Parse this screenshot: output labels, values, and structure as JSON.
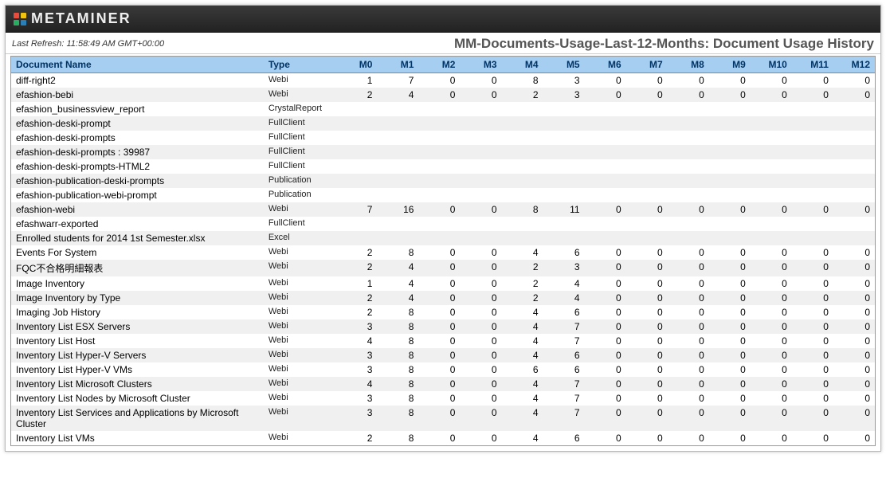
{
  "app": {
    "name": "Metaminer"
  },
  "header": {
    "last_refresh_label": "Last Refresh: 11:58:49 AM GMT+00:00",
    "report_title": "MM-Documents-Usage-Last-12-Months: Document Usage History"
  },
  "columns": {
    "doc_name": "Document Name",
    "type": "Type",
    "months": [
      "M0",
      "M1",
      "M2",
      "M3",
      "M4",
      "M5",
      "M6",
      "M7",
      "M8",
      "M9",
      "M10",
      "M11",
      "M12"
    ]
  },
  "rows": [
    {
      "name": "diff-right2",
      "type": "Webi",
      "vals": [
        "1",
        "7",
        "0",
        "0",
        "8",
        "3",
        "0",
        "0",
        "0",
        "0",
        "0",
        "0",
        "0"
      ]
    },
    {
      "name": "efashion-bebi",
      "type": "Webi",
      "vals": [
        "2",
        "4",
        "0",
        "0",
        "2",
        "3",
        "0",
        "0",
        "0",
        "0",
        "0",
        "0",
        "0"
      ]
    },
    {
      "name": "efashion_businessview_report",
      "type": "CrystalReport",
      "vals": [
        "",
        "",
        "",
        "",
        "",
        "",
        "",
        "",
        "",
        "",
        "",
        "",
        ""
      ]
    },
    {
      "name": "efashion-deski-prompt",
      "type": "FullClient",
      "vals": [
        "",
        "",
        "",
        "",
        "",
        "",
        "",
        "",
        "",
        "",
        "",
        "",
        ""
      ]
    },
    {
      "name": "efashion-deski-prompts",
      "type": "FullClient",
      "vals": [
        "",
        "",
        "",
        "",
        "",
        "",
        "",
        "",
        "",
        "",
        "",
        "",
        ""
      ]
    },
    {
      "name": "efashion-deski-prompts : 39987",
      "type": "FullClient",
      "vals": [
        "",
        "",
        "",
        "",
        "",
        "",
        "",
        "",
        "",
        "",
        "",
        "",
        ""
      ]
    },
    {
      "name": "efashion-deski-prompts-HTML2",
      "type": "FullClient",
      "vals": [
        "",
        "",
        "",
        "",
        "",
        "",
        "",
        "",
        "",
        "",
        "",
        "",
        ""
      ]
    },
    {
      "name": "efashion-publication-deski-prompts",
      "type": "Publication",
      "vals": [
        "",
        "",
        "",
        "",
        "",
        "",
        "",
        "",
        "",
        "",
        "",
        "",
        ""
      ]
    },
    {
      "name": "efashion-publication-webi-prompt",
      "type": "Publication",
      "vals": [
        "",
        "",
        "",
        "",
        "",
        "",
        "",
        "",
        "",
        "",
        "",
        "",
        ""
      ]
    },
    {
      "name": "efashion-webi",
      "type": "Webi",
      "vals": [
        "7",
        "16",
        "0",
        "0",
        "8",
        "11",
        "0",
        "0",
        "0",
        "0",
        "0",
        "0",
        "0"
      ]
    },
    {
      "name": "efashwarr-exported",
      "type": "FullClient",
      "vals": [
        "",
        "",
        "",
        "",
        "",
        "",
        "",
        "",
        "",
        "",
        "",
        "",
        ""
      ]
    },
    {
      "name": "Enrolled students for 2014 1st Semester.xlsx",
      "type": "Excel",
      "vals": [
        "",
        "",
        "",
        "",
        "",
        "",
        "",
        "",
        "",
        "",
        "",
        "",
        ""
      ]
    },
    {
      "name": "Events For System",
      "type": "Webi",
      "vals": [
        "2",
        "8",
        "0",
        "0",
        "4",
        "6",
        "0",
        "0",
        "0",
        "0",
        "0",
        "0",
        "0"
      ]
    },
    {
      "name": "FQC不合格明細報表",
      "type": "Webi",
      "vals": [
        "2",
        "4",
        "0",
        "0",
        "2",
        "3",
        "0",
        "0",
        "0",
        "0",
        "0",
        "0",
        "0"
      ]
    },
    {
      "name": "Image Inventory",
      "type": "Webi",
      "vals": [
        "1",
        "4",
        "0",
        "0",
        "2",
        "4",
        "0",
        "0",
        "0",
        "0",
        "0",
        "0",
        "0"
      ]
    },
    {
      "name": "Image Inventory by Type",
      "type": "Webi",
      "vals": [
        "2",
        "4",
        "0",
        "0",
        "2",
        "4",
        "0",
        "0",
        "0",
        "0",
        "0",
        "0",
        "0"
      ]
    },
    {
      "name": "Imaging Job History",
      "type": "Webi",
      "vals": [
        "2",
        "8",
        "0",
        "0",
        "4",
        "6",
        "0",
        "0",
        "0",
        "0",
        "0",
        "0",
        "0"
      ]
    },
    {
      "name": "Inventory List ESX Servers",
      "type": "Webi",
      "vals": [
        "3",
        "8",
        "0",
        "0",
        "4",
        "7",
        "0",
        "0",
        "0",
        "0",
        "0",
        "0",
        "0"
      ]
    },
    {
      "name": "Inventory List Host",
      "type": "Webi",
      "vals": [
        "4",
        "8",
        "0",
        "0",
        "4",
        "7",
        "0",
        "0",
        "0",
        "0",
        "0",
        "0",
        "0"
      ]
    },
    {
      "name": "Inventory List Hyper-V Servers",
      "type": "Webi",
      "vals": [
        "3",
        "8",
        "0",
        "0",
        "4",
        "6",
        "0",
        "0",
        "0",
        "0",
        "0",
        "0",
        "0"
      ]
    },
    {
      "name": "Inventory List Hyper-V VMs",
      "type": "Webi",
      "vals": [
        "3",
        "8",
        "0",
        "0",
        "6",
        "6",
        "0",
        "0",
        "0",
        "0",
        "0",
        "0",
        "0"
      ]
    },
    {
      "name": "Inventory List Microsoft Clusters",
      "type": "Webi",
      "vals": [
        "4",
        "8",
        "0",
        "0",
        "4",
        "7",
        "0",
        "0",
        "0",
        "0",
        "0",
        "0",
        "0"
      ]
    },
    {
      "name": "Inventory List Nodes by Microsoft Cluster",
      "type": "Webi",
      "vals": [
        "3",
        "8",
        "0",
        "0",
        "4",
        "7",
        "0",
        "0",
        "0",
        "0",
        "0",
        "0",
        "0"
      ]
    },
    {
      "name": "Inventory List Services and Applications by Microsoft Cluster",
      "type": "Webi",
      "vals": [
        "3",
        "8",
        "0",
        "0",
        "4",
        "7",
        "0",
        "0",
        "0",
        "0",
        "0",
        "0",
        "0"
      ]
    },
    {
      "name": "Inventory List VMs",
      "type": "Webi",
      "vals": [
        "2",
        "8",
        "0",
        "0",
        "4",
        "6",
        "0",
        "0",
        "0",
        "0",
        "0",
        "0",
        "0"
      ]
    }
  ]
}
